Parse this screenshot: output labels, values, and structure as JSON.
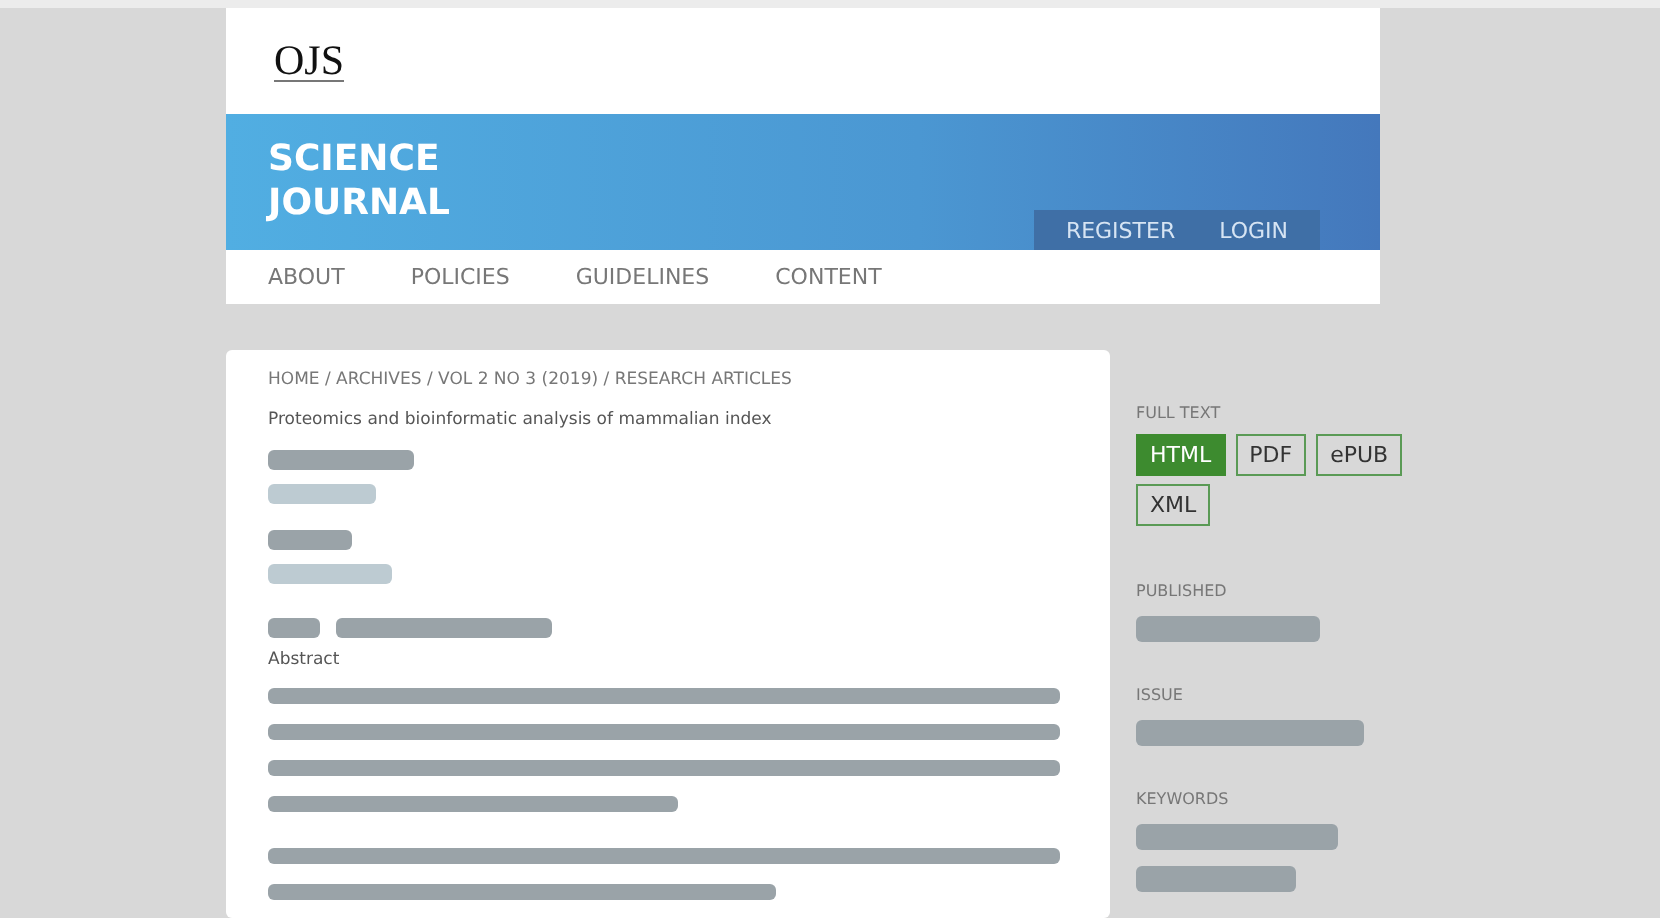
{
  "logo": {
    "text": "OJS"
  },
  "journal_title": [
    "SCIENCE",
    "JOURNAL"
  ],
  "user_nav": [
    "REGISTER",
    "LOGIN"
  ],
  "primary_nav": [
    "ABOUT",
    "POLICIES",
    "GUIDELINES",
    "CONTENT"
  ],
  "breadcrumb": "HOME / ARCHIVES / VOL 2 NO 3 (2019) / RESEARCH ARTICLES",
  "article": {
    "title": "Proteomics and bioinformatic analysis of mammalian index",
    "abstract_heading": "Abstract"
  },
  "sidebar": {
    "full_text_heading": "FULL TEXT",
    "galleys": [
      {
        "label": "HTML",
        "selected": true
      },
      {
        "label": "PDF",
        "selected": false
      },
      {
        "label": "ePUB",
        "selected": false
      },
      {
        "label": "XML",
        "selected": false
      }
    ],
    "sections": [
      "PUBLISHED",
      "ISSUE",
      "KEYWORDS"
    ]
  }
}
